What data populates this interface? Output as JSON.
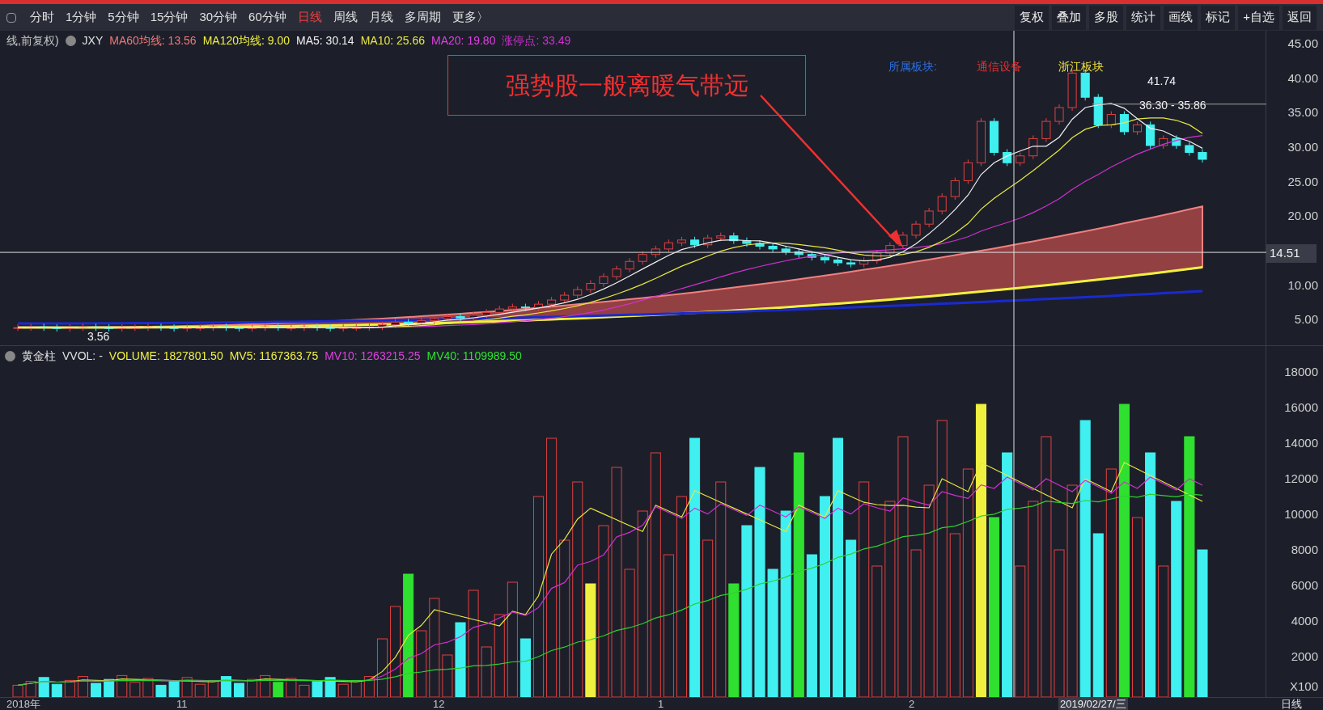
{
  "toolbar": {
    "periods": [
      {
        "label": "分时",
        "selected": false
      },
      {
        "label": "1分钟",
        "selected": false
      },
      {
        "label": "5分钟",
        "selected": false
      },
      {
        "label": "15分钟",
        "selected": false
      },
      {
        "label": "30分钟",
        "selected": false
      },
      {
        "label": "60分钟",
        "selected": false
      },
      {
        "label": "日线",
        "selected": true
      },
      {
        "label": "周线",
        "selected": false
      },
      {
        "label": "月线",
        "selected": false
      },
      {
        "label": "多周期",
        "selected": false
      },
      {
        "label": "更多〉",
        "selected": false
      }
    ],
    "tools": [
      "复权",
      "叠加",
      "多股",
      "统计",
      "画线",
      "标记",
      "+自选",
      "返回"
    ]
  },
  "price_panel": {
    "title": "线,前复权)",
    "indicator": "JXY",
    "legend": [
      {
        "text": "MA60均线: 13.56",
        "color": "#f07878"
      },
      {
        "text": "MA120均线: 9.00",
        "color": "#f0f040"
      },
      {
        "text": "MA5: 30.14",
        "color": "#f0f0f0"
      },
      {
        "text": "MA10: 25.66",
        "color": "#e8e840"
      },
      {
        "text": "MA20: 19.80",
        "color": "#e040e0"
      },
      {
        "text": "涨停点: 33.49",
        "color": "#d030d0"
      }
    ],
    "annotation": "强势股一般离暖气带远",
    "labels": [
      {
        "text": "所属板块:",
        "color": "#2f6fe0"
      },
      {
        "text": "通信设备",
        "color": "#e03030"
      },
      {
        "text": "浙江板块",
        "color": "#f0e040"
      },
      {
        "text": "41.74",
        "color": "#f0f0f0"
      },
      {
        "text": "36.30 - 35.86",
        "color": "#f0f0f0"
      },
      {
        "text": "3.56",
        "color": "#f0f0f0"
      }
    ],
    "axis": [
      "45.00",
      "40.00",
      "35.00",
      "30.00",
      "25.00",
      "20.00",
      "10.00",
      "5.00"
    ],
    "crosshair_value": "14.51"
  },
  "volume_panel": {
    "title": "黄金柱",
    "indicator": "VVOL: -",
    "legend": [
      {
        "text": "VOLUME: 1827801.50",
        "color": "#f0f040"
      },
      {
        "text": "MV5: 1167363.75",
        "color": "#f0f040"
      },
      {
        "text": "MV10: 1263215.25",
        "color": "#e040e0"
      },
      {
        "text": "MV40: 1109989.50",
        "color": "#30e030"
      }
    ],
    "axis": [
      "18000",
      "16000",
      "14000",
      "12000",
      "10000",
      "8000",
      "6000",
      "4000",
      "2000"
    ],
    "unit": "X100"
  },
  "date_axis": [
    "2018年",
    "11",
    "12",
    "1",
    "2"
  ],
  "crosshair_date": "2019/02/27/三",
  "period_label": "日线"
}
